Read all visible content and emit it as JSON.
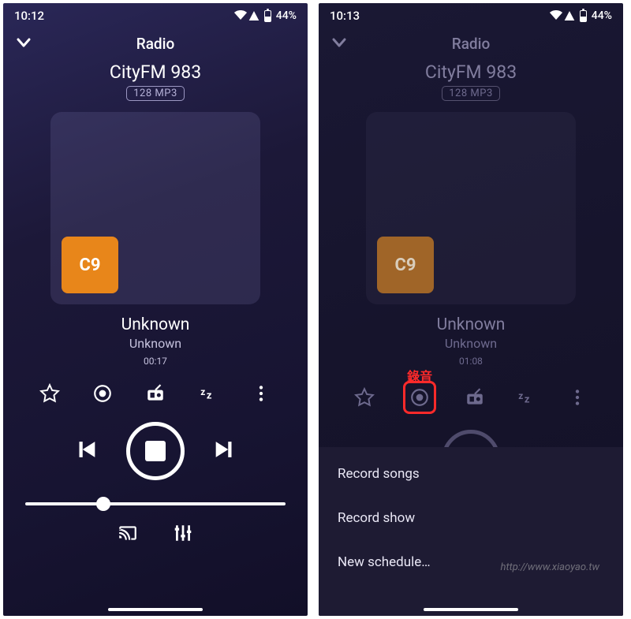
{
  "left": {
    "status": {
      "time": "10:12",
      "battery": "44%"
    },
    "header": {
      "title": "Radio"
    },
    "station": {
      "name": "CityFM 983",
      "badge": "128 MP3",
      "thumb": "C9"
    },
    "track": {
      "title": "Unknown",
      "artist": "Unknown",
      "elapsed": "00:17"
    }
  },
  "right": {
    "status": {
      "time": "10:13",
      "battery": "44%"
    },
    "header": {
      "title": "Radio"
    },
    "station": {
      "name": "CityFM 983",
      "badge": "128 MP3",
      "thumb": "C9"
    },
    "track": {
      "title": "Unknown",
      "artist": "Unknown",
      "elapsed": "01:08"
    },
    "record_label": "錄音",
    "sheet": {
      "item1": "Record songs",
      "item2": "Record show",
      "item3": "New schedule…"
    }
  },
  "watermark": "http://www.xiaoyao.tw"
}
